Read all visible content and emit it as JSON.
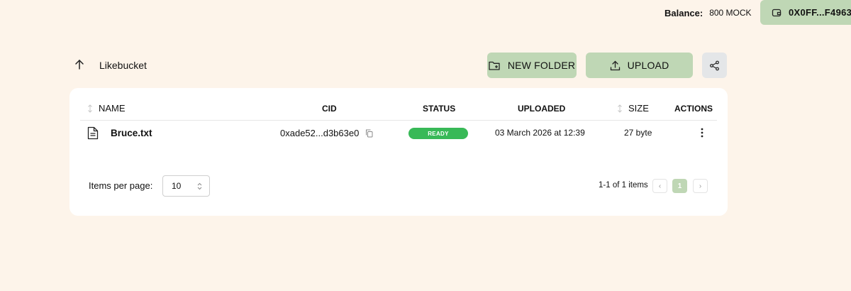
{
  "header": {
    "balance_label": "Balance:",
    "balance_value": "800 MOCK",
    "wallet_address": "0X0FF...F4963"
  },
  "toolbar": {
    "breadcrumb": "Likebucket",
    "new_folder_label": "NEW FOLDER",
    "upload_label": "UPLOAD"
  },
  "table": {
    "columns": {
      "name": "NAME",
      "cid": "CID",
      "status": "STATUS",
      "uploaded": "UPLOADED",
      "size": "SIZE",
      "actions": "ACTIONS"
    },
    "rows": [
      {
        "name": "Bruce.txt",
        "cid": "0xade52...d3b63e0",
        "status": "READY",
        "uploaded": "03 March 2026 at 12:39",
        "size": "27 byte"
      }
    ]
  },
  "pagination": {
    "items_per_page_label": "Items per page:",
    "items_per_page_value": "10",
    "range_text": "1-1 of 1 items",
    "current_page": "1",
    "prev_glyph": "‹",
    "next_glyph": "›"
  },
  "colors": {
    "background": "#fdf4ea",
    "accent": "#bfd7b5",
    "status_ready": "#38b957"
  }
}
